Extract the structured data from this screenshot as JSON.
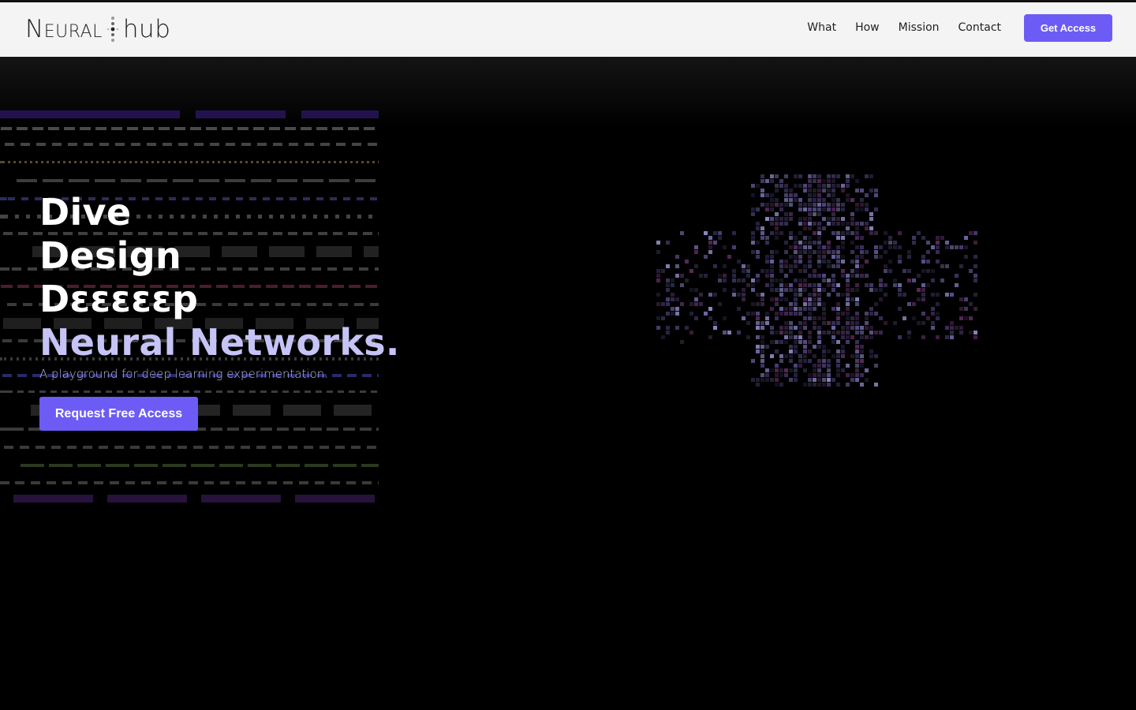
{
  "header": {
    "logo": {
      "part1": "Neural",
      "part2": "hub",
      "icon": "dotted-divider-icon"
    },
    "nav": [
      {
        "label": "What"
      },
      {
        "label": "How"
      },
      {
        "label": "Mission"
      },
      {
        "label": "Contact"
      }
    ],
    "cta_label": "Get Access"
  },
  "hero": {
    "headline": [
      "Dive",
      "Design",
      "Dεεεεεp",
      "Neural Networks."
    ],
    "subtitle": "A playground for deep learning experimentation.",
    "cta_label": "Request Free Access"
  },
  "colors": {
    "accent": "#6c5cf5",
    "headline_accent": "#c6c4f6",
    "nav_bg": "#f4f4f4",
    "hero_bg": "#000000"
  },
  "decorations": {
    "left_field": "dashed-layer-pattern",
    "right_field": "pixelated-network-visualization"
  }
}
